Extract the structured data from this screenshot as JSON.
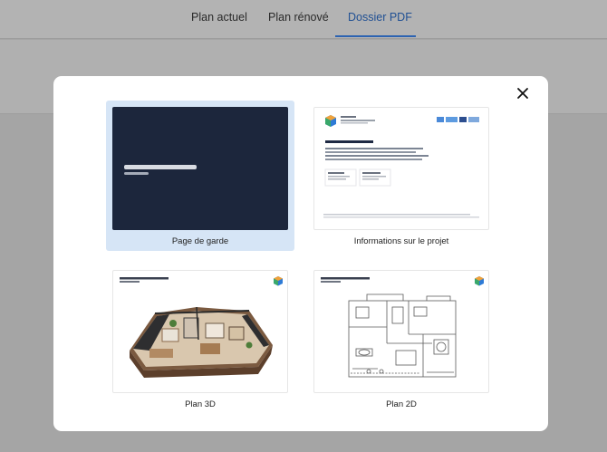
{
  "tabs": [
    {
      "label": "Plan actuel",
      "active": false
    },
    {
      "label": "Plan rénové",
      "active": false
    },
    {
      "label": "Dossier PDF",
      "active": true
    }
  ],
  "modal": {
    "close_icon": "close-icon",
    "cards": [
      {
        "label": "Page de garde",
        "selected": true
      },
      {
        "label": "Informations sur le projet",
        "selected": false
      },
      {
        "label": "Plan 3D",
        "selected": false
      },
      {
        "label": "Plan 2D",
        "selected": false
      }
    ]
  },
  "colors": {
    "accent": "#2d63b1",
    "selected_card": "#d6e5f6",
    "cover_dark": "#1c263c",
    "overlay": "#a5a5a5"
  }
}
